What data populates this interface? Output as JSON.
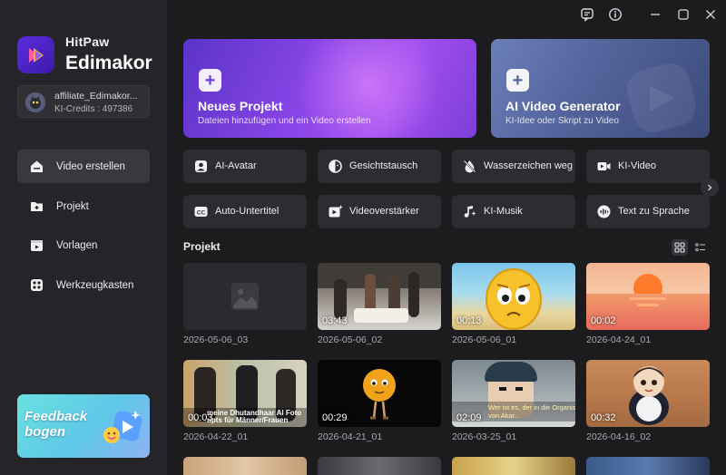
{
  "brand": {
    "line1": "HitPaw",
    "line2": "Edimakor"
  },
  "account": {
    "name": "affiliate_Edimakor...",
    "credits": "KI-Credits : 497386"
  },
  "nav": [
    {
      "label": "Video erstellen",
      "icon": "home-icon",
      "active": true
    },
    {
      "label": "Projekt",
      "icon": "folder-icon",
      "active": false
    },
    {
      "label": "Vorlagen",
      "icon": "templates-icon",
      "active": false
    },
    {
      "label": "Werkzeugkasten",
      "icon": "toolbox-icon",
      "active": false
    }
  ],
  "feedback": {
    "line1": "Feedback",
    "line2": "bogen"
  },
  "hero": {
    "new_project": {
      "title": "Neues Projekt",
      "subtitle": "Dateien hinzufügen und ein Video erstellen",
      "plus": "+"
    },
    "ai_video": {
      "title": "AI Video Generator",
      "subtitle": "KI-Idee oder Skript zu Video",
      "plus": "+"
    }
  },
  "tools": [
    {
      "label": "AI-Avatar",
      "icon": "avatar-icon"
    },
    {
      "label": "Gesichtstausch",
      "icon": "face-swap-icon"
    },
    {
      "label": "Wasserzeichen weg",
      "icon": "watermark-remove-icon"
    },
    {
      "label": "KI-Video",
      "icon": "ai-video-icon"
    },
    {
      "label": "Auto-Untertitel",
      "icon": "subtitle-icon"
    },
    {
      "label": "Videoverstärker",
      "icon": "enhancer-icon"
    },
    {
      "label": "KI-Musik",
      "icon": "music-icon"
    },
    {
      "label": "Text zu Sprache",
      "icon": "text-to-speech-icon"
    }
  ],
  "projects_section": {
    "title": "Projekt"
  },
  "projects": [
    {
      "name": "2026-05-06_03",
      "duration": ""
    },
    {
      "name": "2026-05-06_02",
      "duration": "03:43"
    },
    {
      "name": "2026-05-06_01",
      "duration": "00:13"
    },
    {
      "name": "2026-04-24_01",
      "duration": "00:02"
    },
    {
      "name": "2026-04-22_01",
      "duration": "00:03",
      "overlay_text": "meine Dhutandhaar AI Foto",
      "overlay_text2": "upts für Männer/Frauen"
    },
    {
      "name": "2026-04-21_01",
      "duration": "00:29"
    },
    {
      "name": "2026-03-25_01",
      "duration": "02:09",
      "overlay_text": "Wer ist es, der in die Organisation",
      "overlay_text2": "von Akar..."
    },
    {
      "name": "2026-04-16_02",
      "duration": "00:32"
    }
  ],
  "colors": {
    "accent": "#7b45e6",
    "sidebar_bg": "#252529",
    "main_bg": "#1c1c1f"
  }
}
